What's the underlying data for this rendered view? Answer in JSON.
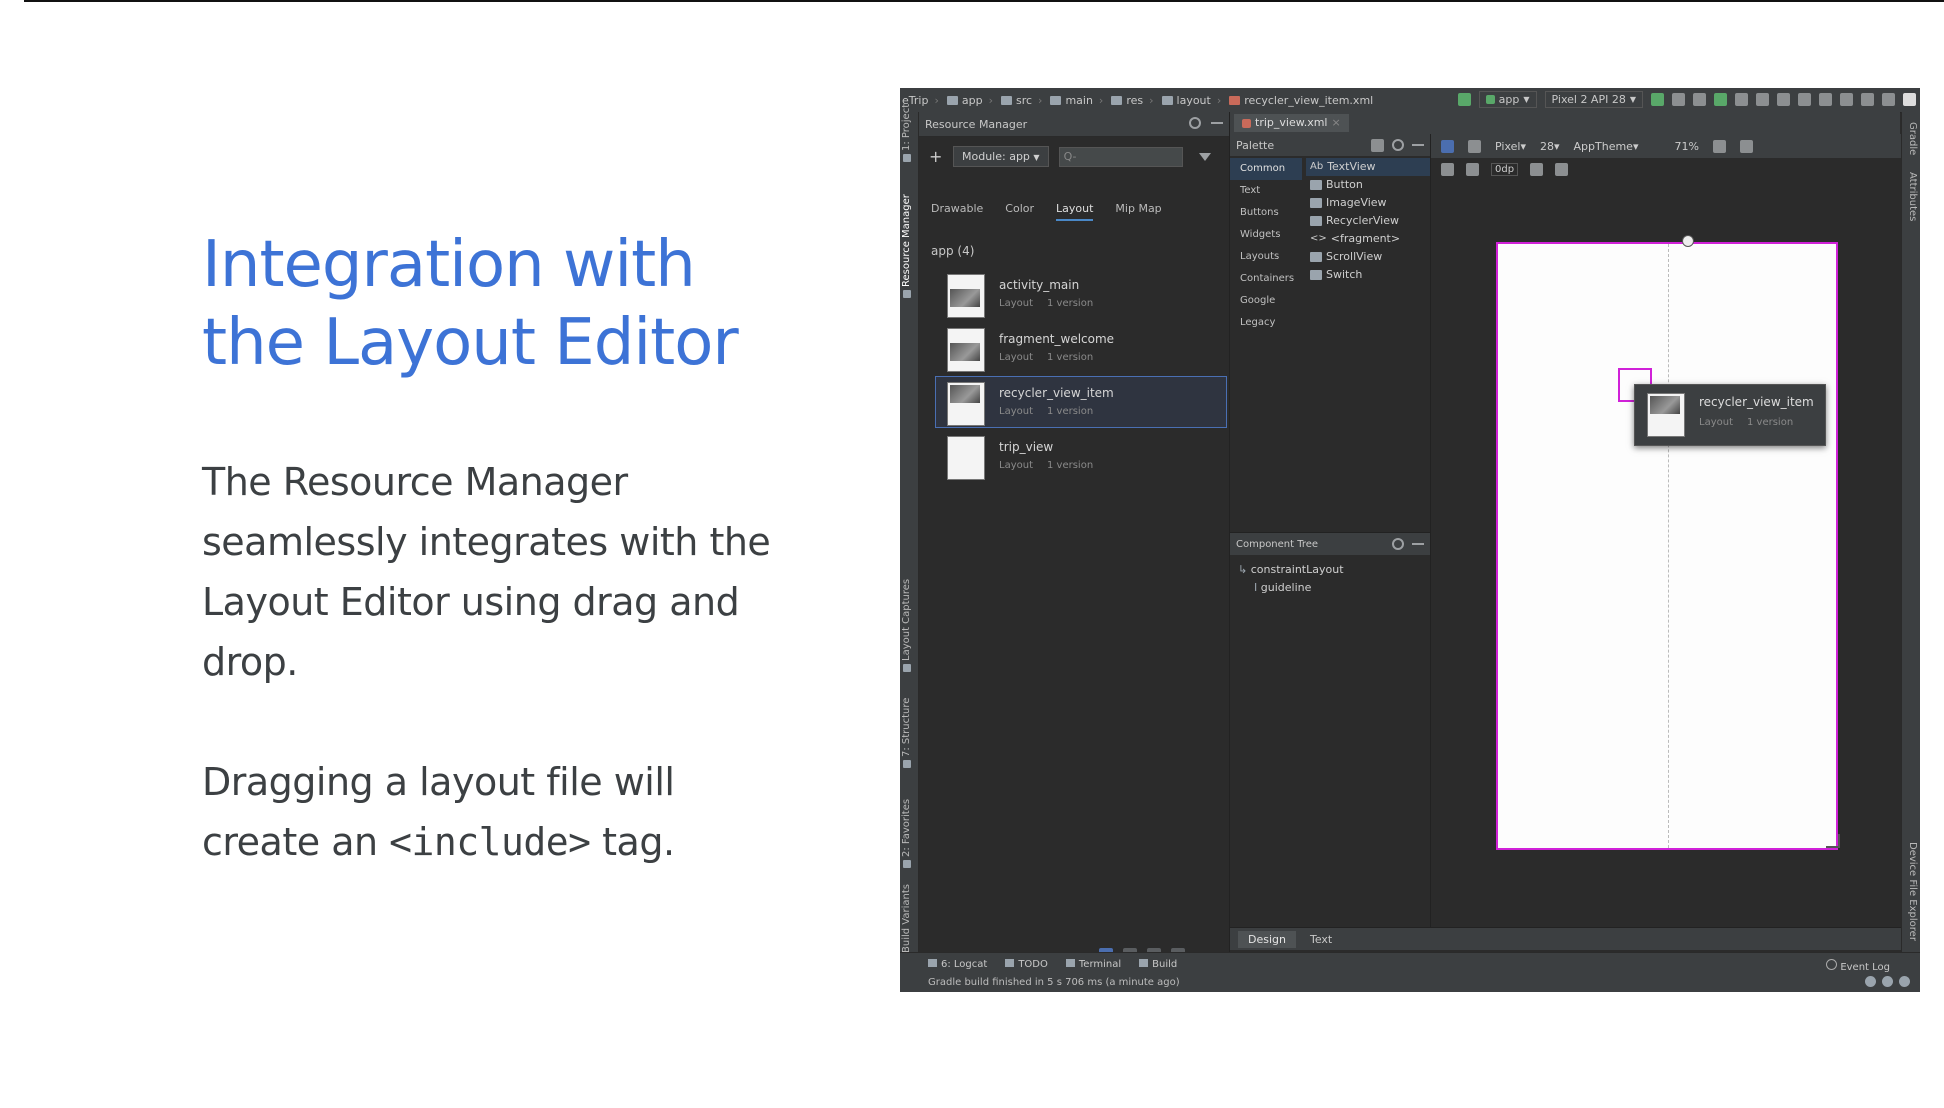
{
  "slide": {
    "title_line1": "Integration with",
    "title_line2": "the Layout Editor",
    "para1": "The Resource Manager seamlessly integrates with the Layout Editor using drag and drop.",
    "para2_prefix": "Dragging a layout file will create an ",
    "para2_code": "<include>",
    "para2_suffix": " tag."
  },
  "ide": {
    "breadcrumbs": [
      "eTrip",
      "app",
      "src",
      "main",
      "res",
      "layout",
      "recycler_view_item.xml"
    ],
    "run_config": "app",
    "device": "Pixel 2 API 28",
    "left_tabs": [
      "1: Project",
      "Resource Manager",
      "Layout Captures",
      "7: Structure",
      "2: Favorites",
      "Build Variants"
    ],
    "right_tabs": [
      "Gradle",
      "Attributes",
      "Device File Explorer"
    ],
    "resource_manager": {
      "title": "Resource Manager",
      "add": "+",
      "module_label": "Module: app",
      "search_placeholder": "Q-",
      "tabs": [
        "Drawable",
        "Color",
        "Layout",
        "Mip Map"
      ],
      "group": "app (4)",
      "items": [
        {
          "name": "activity_main",
          "type": "Layout",
          "versions": "1 version"
        },
        {
          "name": "fragment_welcome",
          "type": "Layout",
          "versions": "1 version"
        },
        {
          "name": "recycler_view_item",
          "type": "Layout",
          "versions": "1 version"
        },
        {
          "name": "trip_view",
          "type": "Layout",
          "versions": "1 version"
        }
      ]
    },
    "editor": {
      "file_tab": "trip_view.xml",
      "palette_title": "Palette",
      "categories": [
        "Common",
        "Text",
        "Buttons",
        "Widgets",
        "Layouts",
        "Containers",
        "Google",
        "Legacy"
      ],
      "widgets": [
        "TextView",
        "Button",
        "ImageView",
        "RecyclerView",
        "<fragment>",
        "ScrollView",
        "Switch"
      ],
      "widget_icons": [
        "Ab",
        "",
        "",
        "",
        "<>",
        "",
        ""
      ],
      "component_tree_title": "Component Tree",
      "tree": [
        "constraintLayout",
        "guideline"
      ],
      "toolbar": {
        "device": "Pixel",
        "api": "28",
        "theme": "AppTheme",
        "zoom": "71%",
        "margin": "0dp"
      },
      "drag_item": {
        "name": "recycler_view_item",
        "type": "Layout",
        "versions": "1 version"
      },
      "bottom_tabs": [
        "Design",
        "Text"
      ]
    },
    "tool_windows": [
      "6: Logcat",
      "TODO",
      "Terminal",
      "Build"
    ],
    "event_log": "Event Log",
    "status_message": "Gradle build finished in 5 s 706 ms (a minute ago)"
  }
}
